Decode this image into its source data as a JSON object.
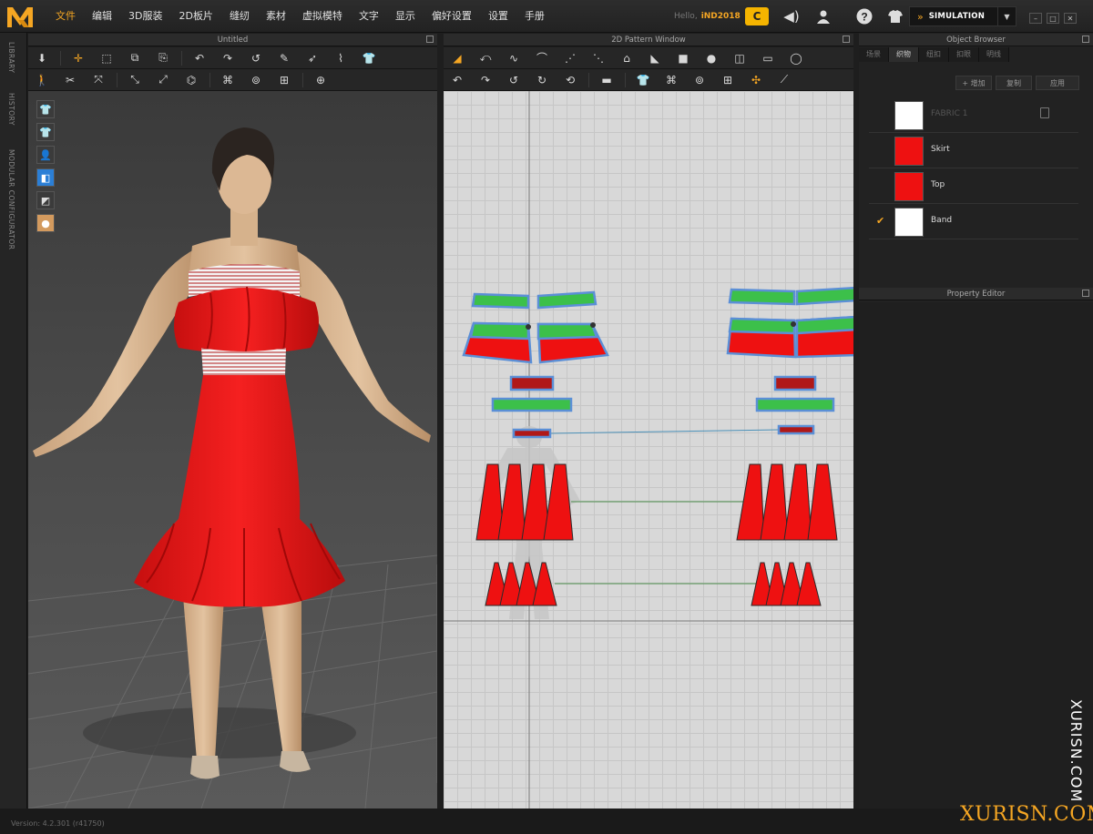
{
  "menubar": {
    "items": [
      "文件",
      "编辑",
      "3D服装",
      "2D板片",
      "缝纫",
      "素材",
      "虚拟模特",
      "文字",
      "显示",
      "偏好设置",
      "设置",
      "手册"
    ],
    "hello_label": "Hello",
    "user": "iND2018",
    "simulation_label": "SIMULATION"
  },
  "side_tabs": [
    "LIBRARY",
    "HISTORY",
    "MODULAR CONFIGURATOR"
  ],
  "panels": {
    "view3d_title": "Untitled",
    "pattern2d_title": "2D Pattern Window",
    "object_browser_title": "Object Browser",
    "property_editor_title": "Property Editor"
  },
  "object_browser": {
    "tabs": [
      "场景",
      "织物",
      "纽扣",
      "扣眼",
      "明线"
    ],
    "active_tab": 1,
    "actions": [
      "+ 增加",
      "复制",
      "应用"
    ],
    "fabrics": [
      {
        "name": "FABRIC 1",
        "color": "#ffffff",
        "checked": false,
        "dim": true
      },
      {
        "name": "Skirt",
        "color": "#ee1111",
        "checked": false,
        "dim": false
      },
      {
        "name": "Top",
        "color": "#ee1111",
        "checked": false,
        "dim": false
      },
      {
        "name": "Band",
        "color": "#ffffff",
        "checked": true,
        "dim": false
      }
    ]
  },
  "status": {
    "version": "Version: 4.2.301 (r41750)"
  },
  "watermark": {
    "vertical": "XURISN.COM",
    "horizontal": "XURISN.COM"
  },
  "colors": {
    "accent": "#f5a623",
    "fabric_red": "#ee1111",
    "band_green": "#3cc04a",
    "band_dark_red": "#b01818"
  }
}
